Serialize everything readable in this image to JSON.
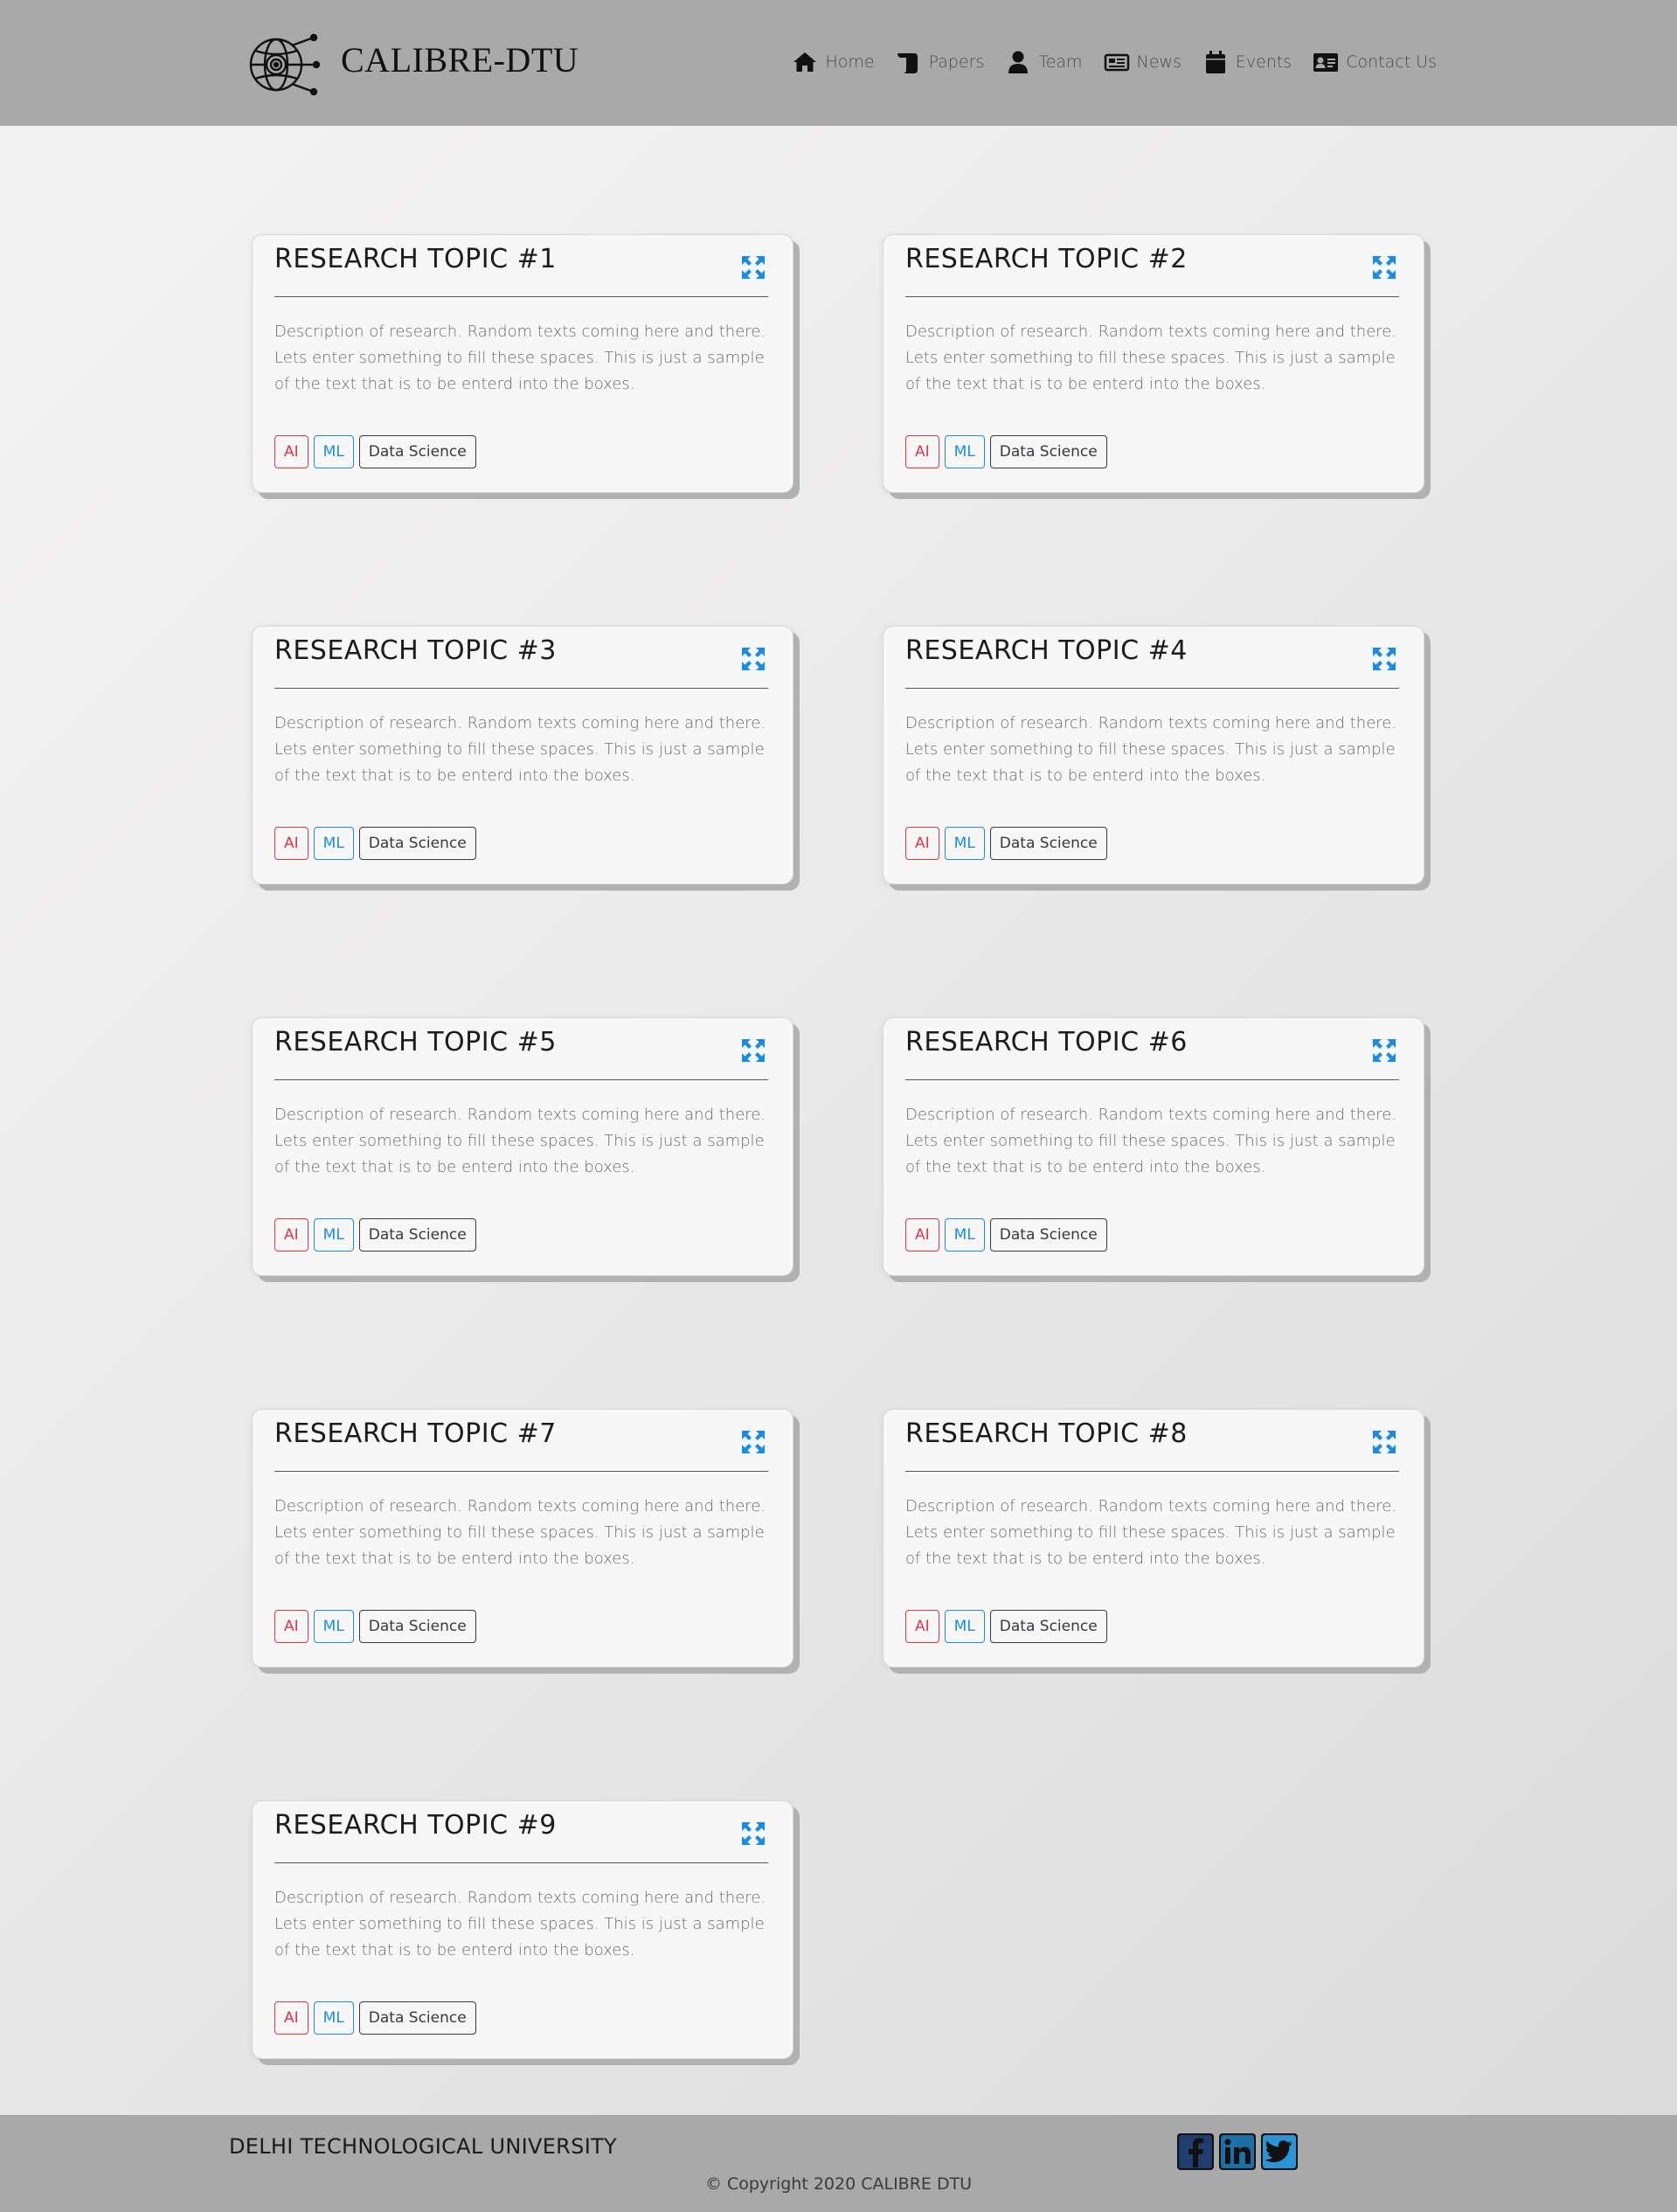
{
  "header": {
    "brand_title": "CALIBRE-DTU",
    "logo_icon": "globe-ai-brain-icon",
    "nav": [
      {
        "label": "Home",
        "icon": "home-icon"
      },
      {
        "label": "Papers",
        "icon": "scroll-icon"
      },
      {
        "label": "Team",
        "icon": "user-icon"
      },
      {
        "label": "News",
        "icon": "newspaper-icon"
      },
      {
        "label": "Events",
        "icon": "calendar-icon"
      },
      {
        "label": "Contact Us",
        "icon": "address-card-icon"
      }
    ]
  },
  "cards": [
    {
      "title": "RESEARCH TOPIC #1",
      "description": "Description of research. Random texts coming here and there. Lets enter something to fill these spaces. This is just a sample of the text that is to be enterd into the boxes.",
      "tags": [
        "AI",
        "ML",
        "Data Science"
      ]
    },
    {
      "title": "RESEARCH TOPIC #2",
      "description": "Description of research. Random texts coming here and there. Lets enter something to fill these spaces. This is just a sample of the text that is to be enterd into the boxes.",
      "tags": [
        "AI",
        "ML",
        "Data Science"
      ]
    },
    {
      "title": "RESEARCH TOPIC #3",
      "description": "Description of research. Random texts coming here and there. Lets enter something to fill these spaces. This is just a sample of the text that is to be enterd into the boxes.",
      "tags": [
        "AI",
        "ML",
        "Data Science"
      ]
    },
    {
      "title": "RESEARCH TOPIC #4",
      "description": "Description of research. Random texts coming here and there. Lets enter something to fill these spaces. This is just a sample of the text that is to be enterd into the boxes.",
      "tags": [
        "AI",
        "ML",
        "Data Science"
      ]
    },
    {
      "title": "RESEARCH TOPIC #5",
      "description": "Description of research. Random texts coming here and there. Lets enter something to fill these spaces. This is just a sample of the text that is to be enterd into the boxes.",
      "tags": [
        "AI",
        "ML",
        "Data Science"
      ]
    },
    {
      "title": "RESEARCH TOPIC #6",
      "description": "Description of research. Random texts coming here and there. Lets enter something to fill these spaces. This is just a sample of the text that is to be enterd into the boxes.",
      "tags": [
        "AI",
        "ML",
        "Data Science"
      ]
    },
    {
      "title": "RESEARCH TOPIC #7",
      "description": "Description of research. Random texts coming here and there. Lets enter something to fill these spaces. This is just a sample of the text that is to be enterd into the boxes.",
      "tags": [
        "AI",
        "ML",
        "Data Science"
      ]
    },
    {
      "title": "RESEARCH TOPIC #8",
      "description": "Description of research. Random texts coming here and there. Lets enter something to fill these spaces. This is just a sample of the text that is to be enterd into the boxes.",
      "tags": [
        "AI",
        "ML",
        "Data Science"
      ]
    },
    {
      "title": "RESEARCH TOPIC #9",
      "description": "Description of research. Random texts coming here and there. Lets enter something to fill these spaces. This is just a sample of the text that is to be enterd into the boxes.",
      "tags": [
        "AI",
        "ML",
        "Data Science"
      ]
    }
  ],
  "card_expand_icon": "expand-icon",
  "colors": {
    "header_bg": "#a9a9a9",
    "tag_ai": "#dc3545",
    "tag_ml": "#1a8ce6",
    "tag_data_science": "#343a40",
    "expand_icon": "#1a8ce6"
  },
  "footer": {
    "university": "DELHI TECHNOLOGICAL UNIVERSITY",
    "copyright": "© Copyright 2020 CALIBRE DTU",
    "socials": [
      {
        "icon": "facebook-icon"
      },
      {
        "icon": "linkedin-icon"
      },
      {
        "icon": "twitter-icon"
      }
    ]
  }
}
